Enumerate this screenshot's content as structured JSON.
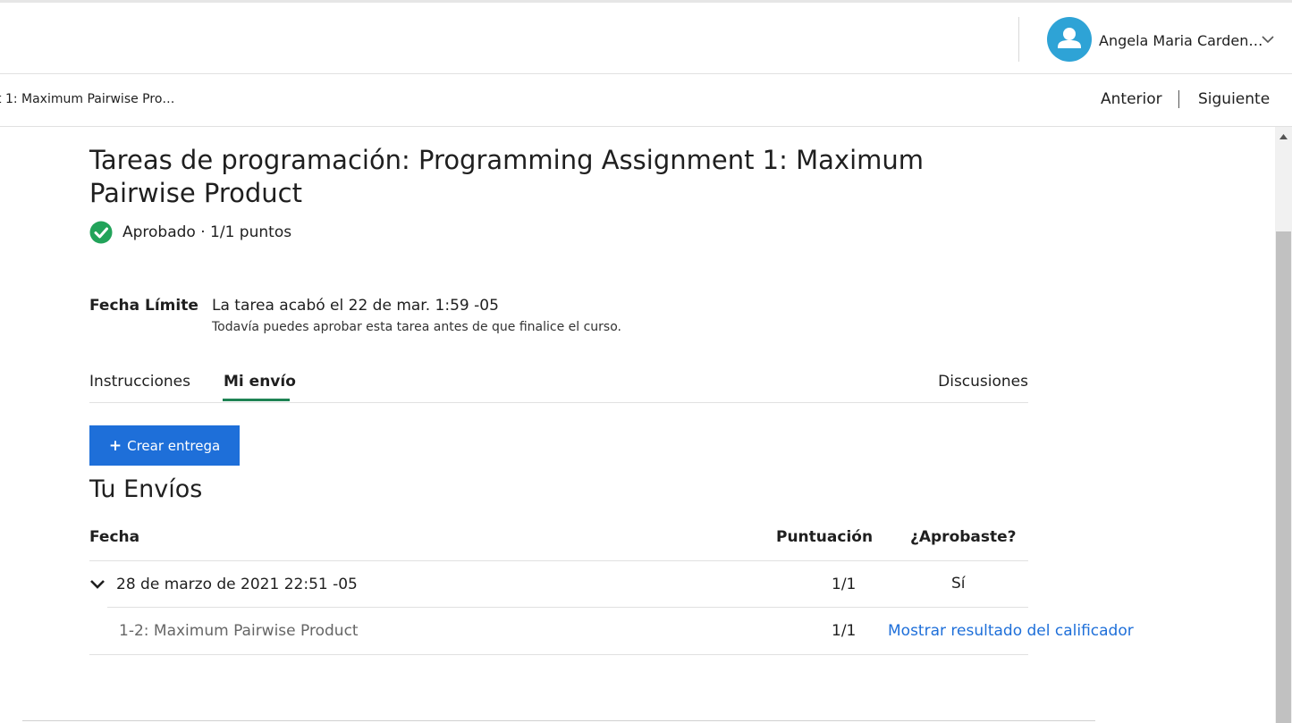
{
  "header": {
    "user_name": "Angela Maria Carden…"
  },
  "nav": {
    "breadcrumb": "t 1: Maximum Pairwise Pro…",
    "previous_label": "Anterior",
    "next_label": "Siguiente"
  },
  "assignment": {
    "title": "Tareas de programación: Programming Assignment 1: Maximum Pairwise Product",
    "status": "Aprobado · 1/1 puntos"
  },
  "deadline": {
    "label": "Fecha Límite",
    "text": "La tarea acabó el 22 de mar. 1:59 -05",
    "note": "Todavía puedes aprobar esta tarea antes de que finalice el curso."
  },
  "tabs": [
    {
      "label": "Instrucciones",
      "active": false
    },
    {
      "label": "Mi envío",
      "active": true
    },
    {
      "label": "Discusiones",
      "active": false
    }
  ],
  "create_button": {
    "icon": "plus-icon",
    "label": "Crear entrega"
  },
  "submissions": {
    "heading": "Tu Envíos",
    "columns": [
      "Fecha",
      "Puntuación",
      "¿Aprobaste?"
    ],
    "rows": [
      {
        "date": "28 de marzo de 2021 22:51 -05",
        "score": "1/1",
        "passed": "Sí"
      }
    ],
    "parts": [
      {
        "name": "1-2: Maximum Pairwise Product",
        "score": "1/1",
        "action": "Mostrar resultado del calificador"
      }
    ]
  },
  "colors": {
    "accent": "#1e6fd9",
    "success": "#22a35a",
    "tab_underline": "#1f8354",
    "avatar": "#2ea3d6"
  }
}
